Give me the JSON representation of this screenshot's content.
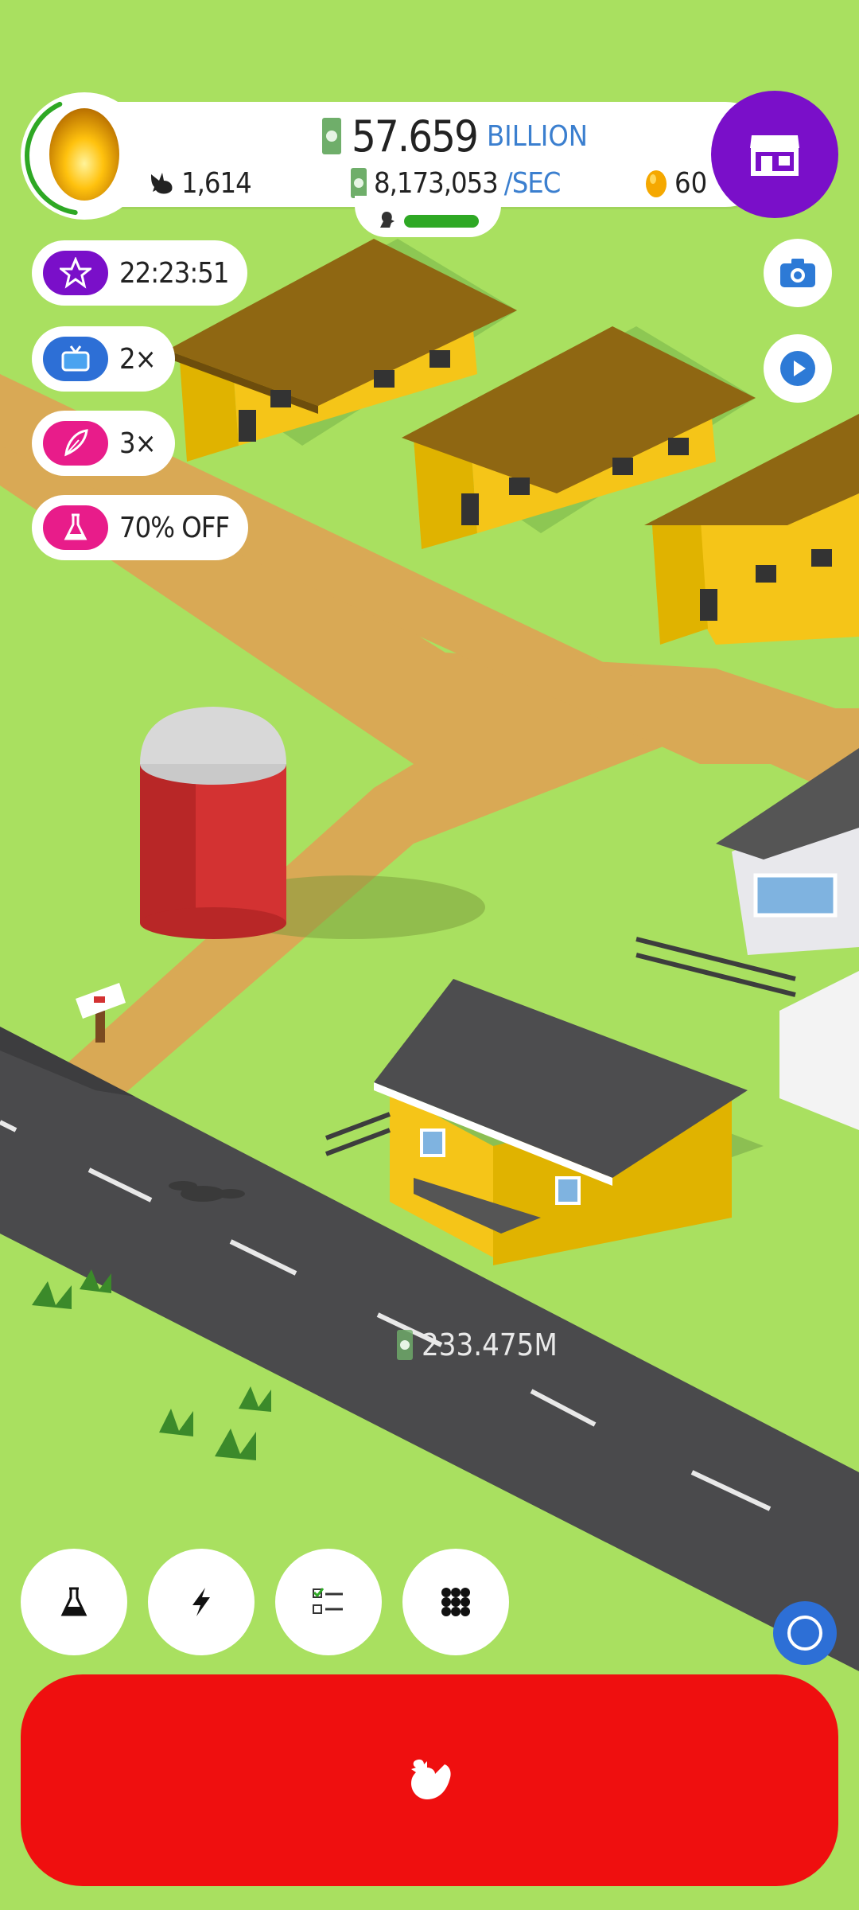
{
  "header": {
    "money_value": "57.659",
    "money_unit": "BILLION",
    "rate_value": "8,173,053",
    "rate_unit": "/SEC",
    "chicken_count": "1,614",
    "golden_eggs": "60",
    "egg_progress": 0.9
  },
  "boosts": [
    {
      "label": "22:23:51",
      "icon": "star-icon",
      "color": "#7a0fc9"
    },
    {
      "label": "2×",
      "icon": "tv-icon",
      "color": "#2d6fd6"
    },
    {
      "label": "3×",
      "icon": "feather-icon",
      "color": "#e81c8a"
    },
    {
      "label": "70% OFF",
      "icon": "flask-icon",
      "color": "#e81c8a"
    }
  ],
  "floating_earnings": "233.475M",
  "toolbar": [
    {
      "icon": "flask-icon"
    },
    {
      "icon": "lightning-icon"
    },
    {
      "icon": "checklist-icon"
    },
    {
      "icon": "grid-menu-icon"
    }
  ],
  "colors": {
    "grass": "#a9e060",
    "shop": "#7a0fc9",
    "hatch": "#ef0f0f",
    "accent_blue": "#3b7fcf",
    "progress": "#2ea824"
  }
}
